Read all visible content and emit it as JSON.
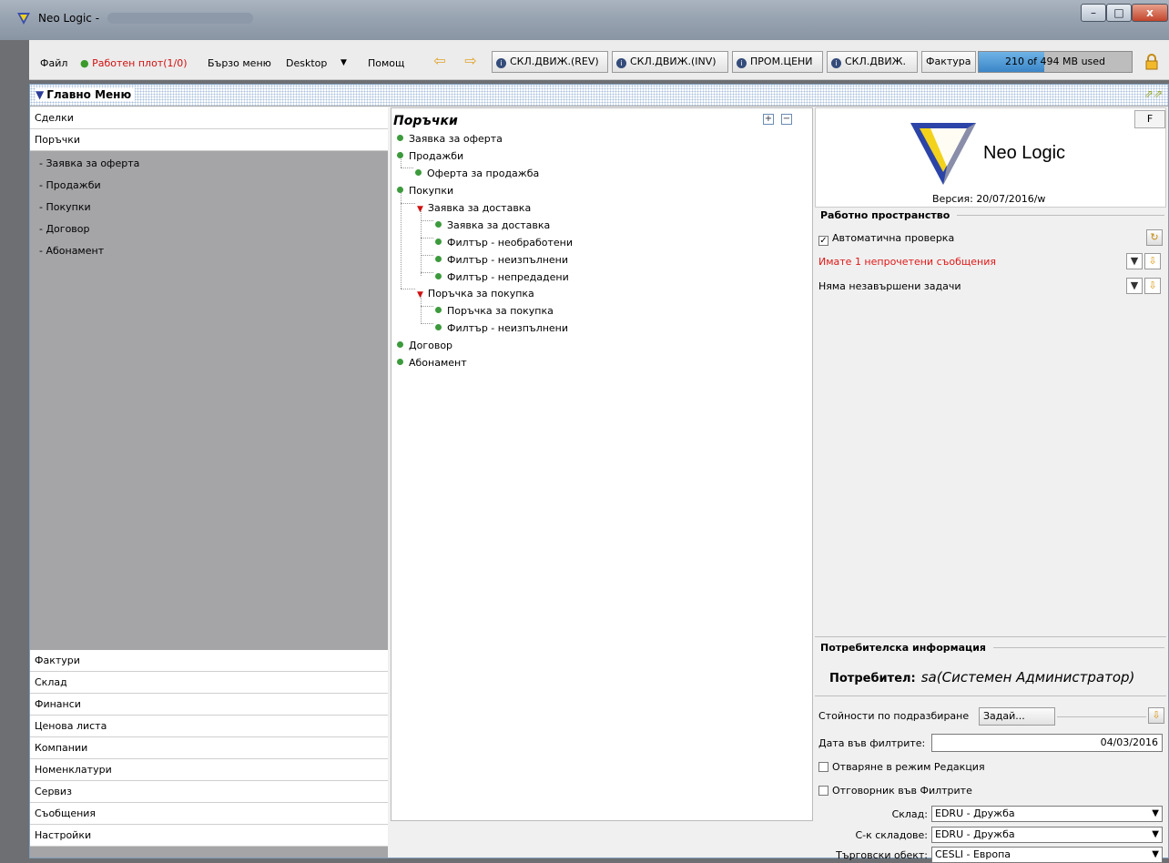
{
  "window": {
    "title": "Neo Logic -",
    "min": "–",
    "max": "□",
    "close": "x"
  },
  "menubar": {
    "file": "Файл",
    "desktop_work": "Работен плот(1/0)",
    "quick_menu": "Бързо меню",
    "desktop": "Desktop",
    "help": "Помощ",
    "tabs": [
      "СКЛ.ДВИЖ.(REV)",
      "СКЛ.ДВИЖ.(INV)",
      "ПРОМ.ЦЕНИ",
      "СКЛ.ДВИЖ."
    ],
    "invoice": "Фактура",
    "memory": "210 of 494 MB used",
    "memory_fraction": 0.43
  },
  "main_menu": {
    "title": "Главно Меню"
  },
  "left": {
    "top_cats": [
      "Сделки",
      "Поръчки"
    ],
    "subs": [
      "- Заявка за оферта",
      "- Продажби",
      "- Покупки",
      "- Договор",
      "- Абонамент"
    ],
    "bottom_cats": [
      "Фактури",
      "Склад",
      "Финанси",
      "Ценова листа",
      "Компании",
      "Номенклатури",
      "Сервиз",
      "Съобщения",
      "Настройки"
    ]
  },
  "tree": {
    "title": "Поръчки",
    "expand": "+",
    "collapse": "−",
    "nodes": [
      "Заявка за оферта",
      "Продажби",
      "Оферта за продажба",
      "Покупки",
      "Заявка за доставка",
      "Заявка за доставка",
      "Филтър - необработени",
      "Филтър - неизпълнени",
      "Филтър - непредадени",
      "Поръчка за покупка",
      "Поръчка за покупка",
      "Филтър - неизпълнени",
      "Договор",
      "Абонамент"
    ]
  },
  "right": {
    "logo": "Neo Logic",
    "version": "Версия: 20/07/2016/w",
    "f_button": "F",
    "workspace": {
      "title": "Работно пространство",
      "auto_check": "Автоматична проверка",
      "messages": "Имате 1 непрочетени съобщения",
      "tasks": "Няма незавършени задачи"
    },
    "user": {
      "title": "Потребителска информация",
      "label": "Потребител:",
      "value": "sa(Системен Администратор)"
    },
    "defaults": {
      "title": "Стойности по подразбиране",
      "set_button": "Задай...",
      "date_label": "Дата във филтрите:",
      "date_value": "04/03/2016",
      "edit_mode": "Отваряне в режим Редакция",
      "responsible": "Отговорник във Филтрите",
      "warehouse_label": "Склад:",
      "warehouse_value": "EDRU - Дружба",
      "warehouses_label": "С-к складове:",
      "warehouses_value": "EDRU - Дружба",
      "object_label": "Търговски обект:",
      "object_value": "CESLI - Европа"
    }
  }
}
